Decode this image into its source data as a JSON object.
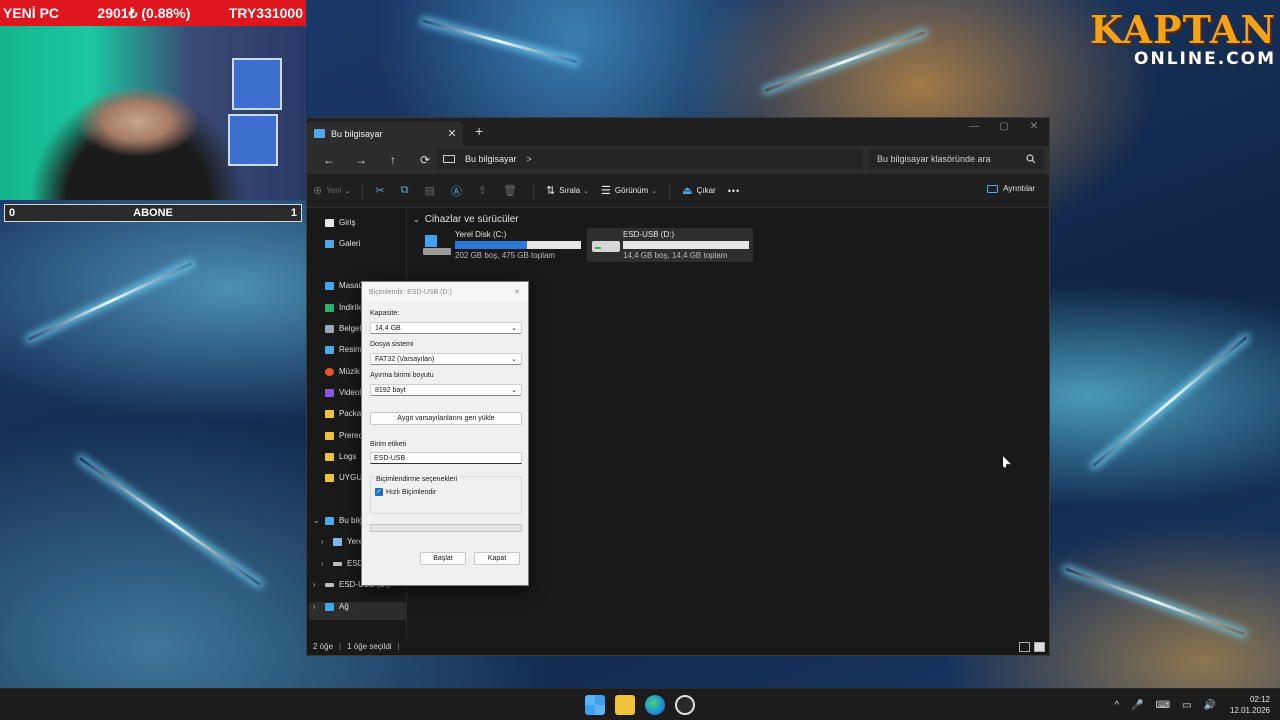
{
  "overlay": {
    "pc_label": "YENİ PC",
    "price": "2901₺ (0.88%)",
    "goal": "TRY331000",
    "sub_left": "0",
    "sub_label": "ABONE",
    "sub_right": "1",
    "brand_line1": "KAPTAN",
    "brand_line2": "ONLINE.COM"
  },
  "window": {
    "tab_title": "Bu bilgisayar",
    "tab_close": "✕",
    "new_tab": "+",
    "controls": [
      "—",
      "▢",
      "✕"
    ],
    "nav": [
      "←",
      "→",
      "↑",
      "⟳"
    ],
    "address": "Bu bilgisayar",
    "address_chevron": ">",
    "search_placeholder": "Bu bilgisayar klasöründe ara",
    "search_icon": "search-icon",
    "commands": {
      "new": "Yeni",
      "sort": "Sırala",
      "view": "Görünüm",
      "eject": "Çıkar",
      "more": "•••",
      "details": "Ayrıntılar"
    },
    "sidebar": {
      "home": "Giriş",
      "gallery": "Galeri",
      "desktop": "Masaü",
      "downloads": "İndirile",
      "documents": "Belgele",
      "pictures": "Resiml",
      "music": "Müzik",
      "videos": "Videol",
      "packages": "Packag",
      "prereq": "Prereq",
      "logs": "Logs",
      "uygul": "UYGUL",
      "this_pc": "Bu bilg",
      "local_disk": "Yerel",
      "esd_1": "ESD-U",
      "esd_2": "ESD-USB (D:)",
      "network": "Ağ"
    },
    "section_title": "Cihazlar ve sürücüler",
    "drives": [
      {
        "name": "Yerel Disk (C:)",
        "free_text": "202 GB boş, 475 GB toplam",
        "used_fraction": 0.575
      },
      {
        "name": "ESD-USB (D:)",
        "free_text": "14,4 GB boş, 14,4 GB toplam",
        "used_fraction": 0.0
      }
    ],
    "status": {
      "items": "2 öğe",
      "selected": "1 öğe seçildi"
    }
  },
  "dialog": {
    "title": "Biçimlendir: ESD-USB (D:)",
    "close": "✕",
    "capacity_label": "Kapasite:",
    "capacity_value": "14,4 GB",
    "fs_label": "Dosya sistemi",
    "fs_value": "FAT32 (Varsayılan)",
    "alloc_label": "Ayırma birimi boyutu",
    "alloc_value": "8192 bayt",
    "restore_button": "Aygıt varsayılanlarını geri yükle",
    "volume_label": "Birim etiketi",
    "volume_value": "ESD-USB",
    "options_label": "Biçimlendirme seçenekleri",
    "quick_format": "Hızlı Biçimlendir",
    "quick_checked": "✓",
    "progress": 0,
    "start_button": "Başlat",
    "close_button": "Kapat",
    "dropdown_arrow": "⌄"
  },
  "taskbar": {
    "time": "02:12",
    "date": "12.01.2026",
    "tray_icons": [
      "^",
      "🎤",
      "⌨",
      "▭",
      "🔊"
    ]
  }
}
